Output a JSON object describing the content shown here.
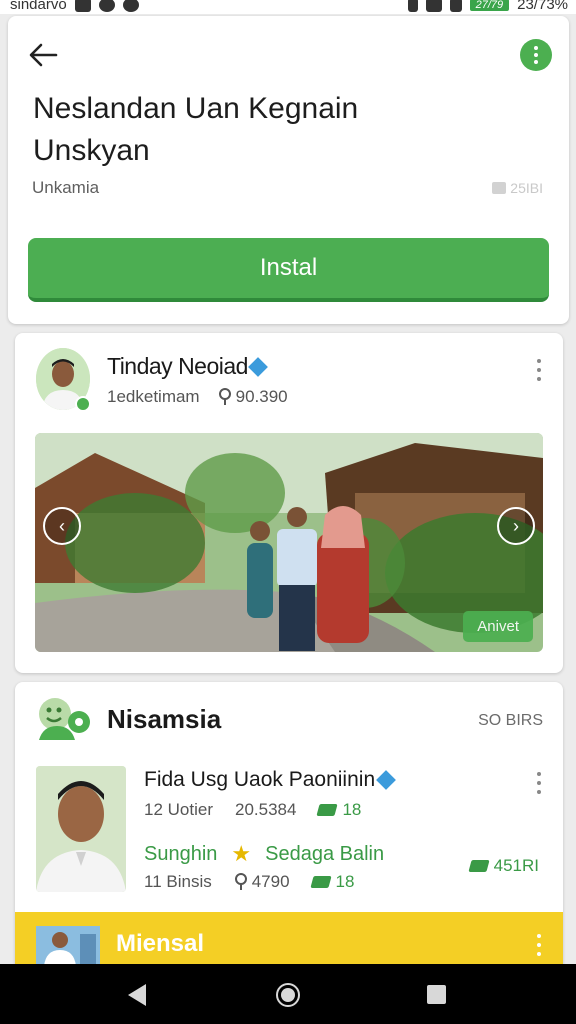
{
  "status_bar": {
    "left_text": "sindarvo",
    "battery_text": "27/79",
    "right_text": "23/73%"
  },
  "app": {
    "title": "Neslandan Uan Kegnain Unskyan",
    "subtitle": "Unkamia",
    "size": "25IBI",
    "install_label": "Instal"
  },
  "post": {
    "name": "Tinday Neoiad",
    "meta_left": "1edketimam",
    "meta_right": "90.390",
    "photo_badge": "Anivet"
  },
  "section": {
    "title": "Nisamsia",
    "right_text": "SO BIRS"
  },
  "item": {
    "title": "Fida Usg Uaok Paoniinin",
    "meta_left": "12 Uotier",
    "meta_mid": "20.5384",
    "meta_tag": "18",
    "green_left": "Sunghin",
    "green_right": "Sedaga Balin",
    "meta2_left": "11 Binsis",
    "meta2_mid": "4790",
    "meta2_tag": "18",
    "side_tag": "451RI"
  },
  "promo": {
    "label": "Miensal"
  },
  "icons": {
    "back": "back-arrow-icon",
    "more": "more-vert-icon",
    "verified": "verified-icon",
    "location": "location-pin-icon",
    "star": "star-icon",
    "tag": "ticket-icon",
    "chat": "chat-group-icon"
  },
  "colors": {
    "accent_green": "#4cae52",
    "promo_yellow": "#f4cf25",
    "verified_blue": "#3b9bdc"
  }
}
